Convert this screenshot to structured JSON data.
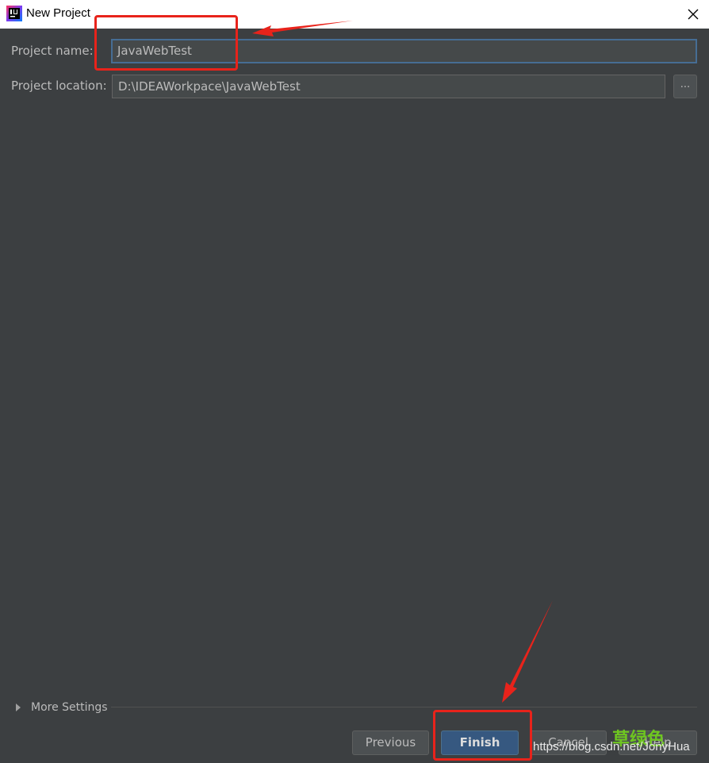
{
  "window": {
    "title": "New Project",
    "app_icon": "intellij-idea-icon",
    "close_icon": "close-icon"
  },
  "form": {
    "project_name_label": "Project name:",
    "project_name_value": "JavaWebTest",
    "project_location_label": "Project location:",
    "project_location_value": "D:\\IDEAWorkpace\\JavaWebTest",
    "browse_label": "..."
  },
  "more_settings": {
    "label": "More Settings"
  },
  "buttons": {
    "previous": "Previous",
    "finish": "Finish",
    "cancel": "Cancel",
    "help": "Help"
  },
  "watermark": {
    "cn_text": "草绿色",
    "url_text": "https://blog.csdn.net/JonyHua"
  },
  "colors": {
    "background": "#3c3f41",
    "accent": "#365880",
    "annotation": "#e8231b",
    "focus_border": "#466d94"
  }
}
